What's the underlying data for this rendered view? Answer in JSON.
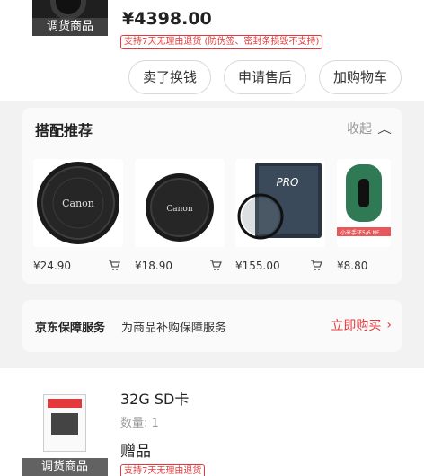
{
  "order": {
    "tag": "调货商品",
    "price": "¥4398.00",
    "return_badge": "支持7天无理由退货 (防伪签、密封条损毁不支持)",
    "buttons": [
      "卖了换钱",
      "申请售后",
      "加购物车"
    ]
  },
  "recommend": {
    "title": "搭配推荐",
    "collapse_label": "收起",
    "products": [
      {
        "price": "¥24.90",
        "label": "Canon"
      },
      {
        "price": "¥18.90",
        "label": "Canon"
      },
      {
        "price": "¥155.00",
        "label": "PRO"
      },
      {
        "price": "¥8.80",
        "label": "小米手环5/6 NF"
      }
    ]
  },
  "service": {
    "title": "京东保障服务",
    "subtitle": "为商品补购保障服务",
    "buy_label": "立即购买"
  },
  "item2": {
    "tag": "调货商品",
    "name": "32G SD卡",
    "qty": "数量: 1",
    "gift": "赠品",
    "return_badge": "支持7天无理由退货"
  },
  "colors": {
    "accent": "#e4393c",
    "muted": "#999999"
  }
}
